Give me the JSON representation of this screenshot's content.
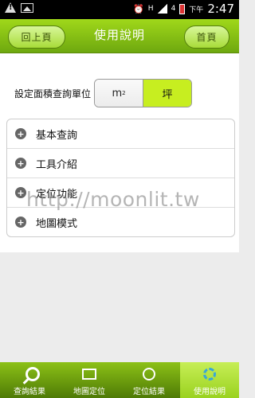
{
  "status_bar": {
    "network": "H",
    "signal_strength": "4",
    "ampm": "下午",
    "time": "2:47"
  },
  "header": {
    "back_label": "回上頁",
    "title": "使用說明",
    "home_label": "首頁"
  },
  "area_unit": {
    "label": "設定面積查詢單位",
    "options": [
      "m",
      "坪"
    ],
    "m2_base": "m",
    "m2_sup": "2",
    "selected": "坪"
  },
  "help_items": [
    {
      "label": "基本查詢"
    },
    {
      "label": "工具介紹"
    },
    {
      "label": "定位功能"
    },
    {
      "label": "地圖模式"
    }
  ],
  "watermark": "http://moonlit.tw",
  "tabs": [
    {
      "label": "查詢結果",
      "icon": "search-icon"
    },
    {
      "label": "地圖定位",
      "icon": "map-icon"
    },
    {
      "label": "定位結果",
      "icon": "globe-icon"
    },
    {
      "label": "使用說明",
      "icon": "gear-icon",
      "active": true
    }
  ],
  "colors": {
    "accent": "#8cc116",
    "selected_segment": "#c7ee20"
  }
}
